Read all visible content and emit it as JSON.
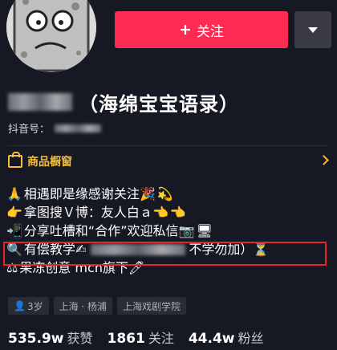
{
  "actions": {
    "follow_label": "关注",
    "follow_plus": "+"
  },
  "profile": {
    "display_name_suffix": "（海绵宝宝语录）",
    "id_label": "抖音号：",
    "shop_label": "商品橱窗"
  },
  "bio": {
    "line1": "相遇即是缘感谢关注",
    "line2": "拿图搜Ｖ博：友人白ａ",
    "line3": "分享吐槽和“合作”欢迎私信",
    "line4_prefix": "有偿教学",
    "line4_suffix": "不学勿加）",
    "line5": "果冻创意 mcn旗下"
  },
  "tags": {
    "age": "3岁",
    "location": "上海 · 杨浦",
    "school": "上海戏剧学院"
  },
  "stats": {
    "likes_value": "535.9w",
    "likes_label": "获赞",
    "following_value": "1861",
    "following_label": "关注",
    "followers_value": "44.4w",
    "followers_label": "粉丝"
  },
  "colors": {
    "background": "#161823",
    "follow_button": "#fe2c55",
    "shop_accent": "#f3bd40",
    "highlight_border": "#e5252a"
  }
}
